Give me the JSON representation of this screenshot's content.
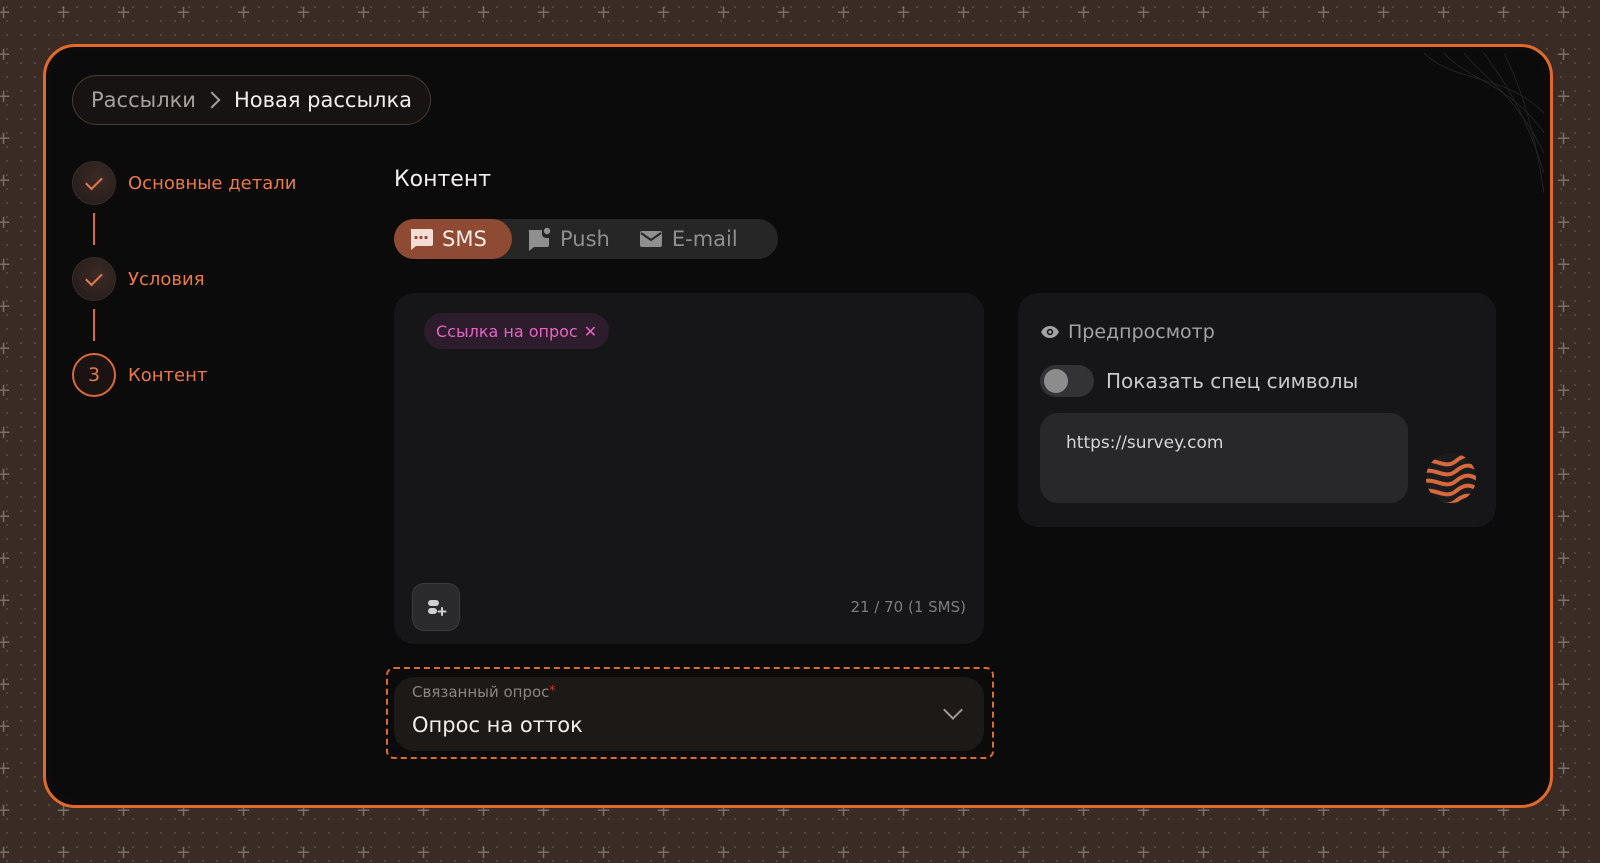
{
  "breadcrumb": {
    "parent": "Рассылки",
    "current": "Новая рассылка"
  },
  "steps": [
    {
      "label": "Основные детали",
      "state": "done"
    },
    {
      "label": "Условия",
      "state": "done"
    },
    {
      "label": "Контент",
      "state": "current",
      "number": "3"
    }
  ],
  "content": {
    "title": "Контент",
    "tabs": [
      {
        "label": "SMS",
        "icon": "sms-icon",
        "active": true
      },
      {
        "label": "Push",
        "icon": "push-icon",
        "active": false
      },
      {
        "label": "E-mail",
        "icon": "email-icon",
        "active": false
      }
    ],
    "editor": {
      "chip": "Ссылка на опрос",
      "counter": "21 / 70 (1 SMS)"
    },
    "survey": {
      "label": "Связанный опрос",
      "required_mark": "*",
      "value": "Опрос на отток"
    }
  },
  "preview": {
    "title": "Предпросмотр",
    "toggle_label": "Показать спец символы",
    "toggle_on": false,
    "message": "https://survey.com"
  },
  "colors": {
    "accent": "#e2692c",
    "chip_text": "#e863c4",
    "active_tab": "#8f4a34"
  }
}
